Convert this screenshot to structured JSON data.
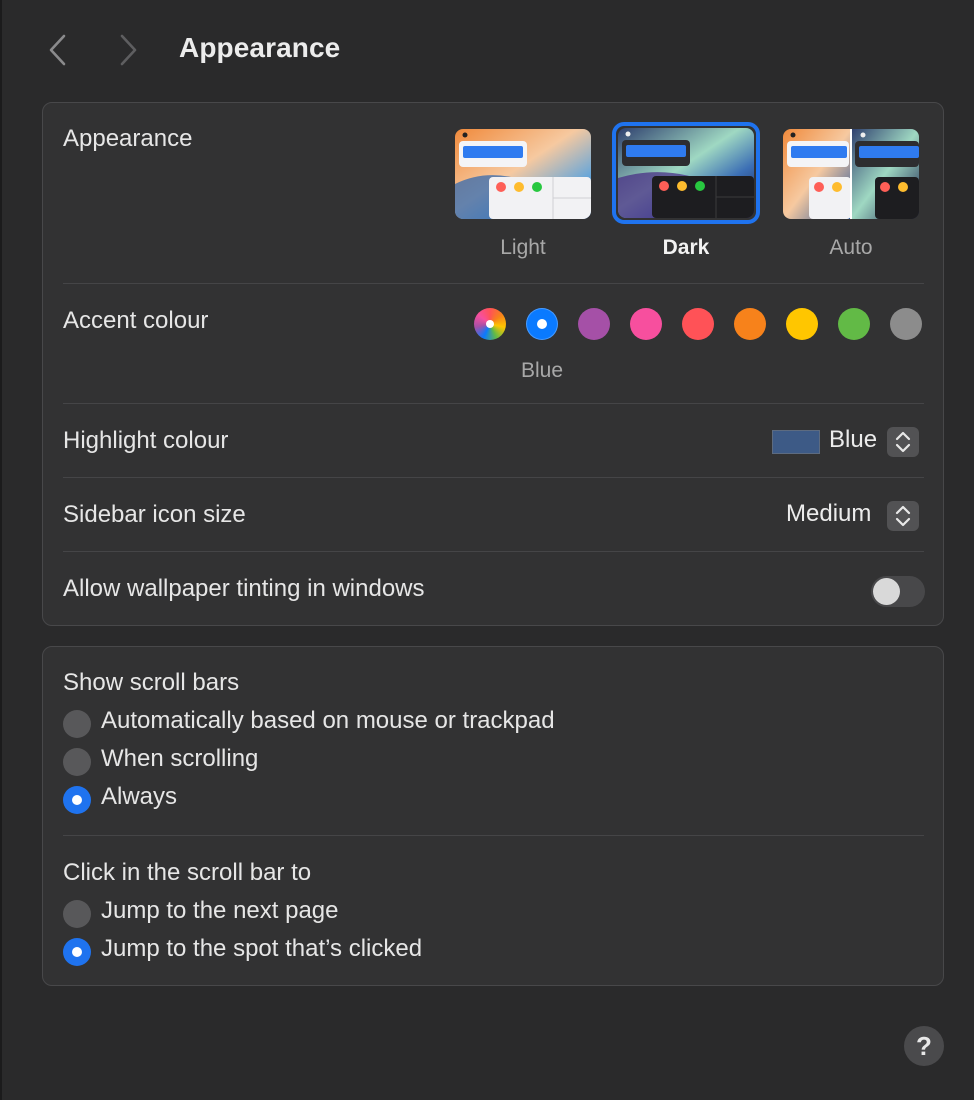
{
  "window": {
    "title": "Appearance"
  },
  "appearance": {
    "label": "Appearance",
    "options": [
      "Light",
      "Dark",
      "Auto"
    ],
    "selected": "Dark"
  },
  "accent": {
    "label": "Accent colour",
    "selected_name": "Blue",
    "swatches": [
      {
        "name": "Multicolour",
        "color": "multicolor"
      },
      {
        "name": "Blue",
        "color": "#0a7aff"
      },
      {
        "name": "Purple",
        "color": "#a550a7"
      },
      {
        "name": "Pink",
        "color": "#f74f9e"
      },
      {
        "name": "Red",
        "color": "#ff5257"
      },
      {
        "name": "Orange",
        "color": "#f7821b"
      },
      {
        "name": "Yellow",
        "color": "#ffc600"
      },
      {
        "name": "Green",
        "color": "#62ba46"
      },
      {
        "name": "Graphite",
        "color": "#8c8c8c"
      }
    ]
  },
  "highlight": {
    "label": "Highlight colour",
    "value": "Blue",
    "well_color": "#3d5a86"
  },
  "sidebar_icon": {
    "label": "Sidebar icon size",
    "value": "Medium"
  },
  "tinting": {
    "label": "Allow wallpaper tinting in windows",
    "enabled": false
  },
  "scroll_bars": {
    "label": "Show scroll bars",
    "options": [
      "Automatically based on mouse or trackpad",
      "When scrolling",
      "Always"
    ],
    "selected": "Always"
  },
  "click_scroll": {
    "label": "Click in the scroll bar to",
    "options": [
      "Jump to the next page",
      "Jump to the spot that’s clicked"
    ],
    "selected": "Jump to the spot that’s clicked"
  },
  "help": {
    "glyph": "?"
  },
  "colors": {
    "accent": "#1f73ef",
    "background": "#2a2a2b",
    "panel": "#323233"
  }
}
